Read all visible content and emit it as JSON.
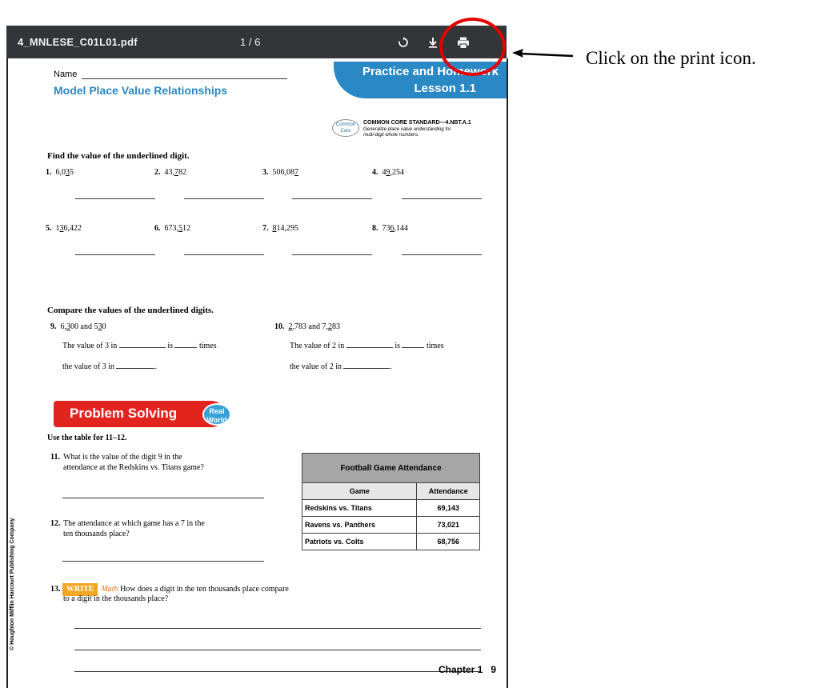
{
  "viewer": {
    "filename": "4_MNLESE_C01L01.pdf",
    "page_indicator": "1 / 6",
    "icons": [
      "rotate-icon",
      "download-icon",
      "print-icon"
    ]
  },
  "worksheet": {
    "name_label": "Name",
    "title": "Model Place Value Relationships",
    "banner_line1": "Practice and Homework",
    "banner_line2": "Lesson 1.1",
    "common_core_badge": "Common Core",
    "standard_heading": "COMMON CORE STANDARD—4.NBT.A.1",
    "standard_text": "Generalize place value understanding for multi-digit whole numbers.",
    "section1_heading": "Find the value of the underlined digit.",
    "problems1": [
      {
        "num": "1.",
        "pre": "6,0",
        "u": "3",
        "post": "5"
      },
      {
        "num": "2.",
        "pre": "43,",
        "u": "7",
        "post": "82"
      },
      {
        "num": "3.",
        "pre": "506,08",
        "u": "7",
        "post": ""
      },
      {
        "num": "4.",
        "pre": "4",
        "u": "9",
        "post": ",254"
      },
      {
        "num": "5.",
        "pre": "1",
        "u": "3",
        "post": "6,422"
      },
      {
        "num": "6.",
        "pre": "673,",
        "u": "5",
        "post": "12"
      },
      {
        "num": "7.",
        "pre": "",
        "u": "8",
        "post": "14,295"
      },
      {
        "num": "8.",
        "pre": "73",
        "u": "6",
        "post": ",144"
      }
    ],
    "section2_heading": "Compare the values of the underlined digits.",
    "p9": {
      "num": "9.",
      "a_pre": "6,",
      "a_u": "3",
      "a_post": "00",
      "and": "and",
      "b_pre": "5",
      "b_u": "3",
      "b_post": "0"
    },
    "p10": {
      "num": "10.",
      "a_pre": "",
      "a_u": "2",
      "a_post": ",783",
      "and": "and",
      "b_pre": "7,",
      "b_u": "2",
      "b_post": "83"
    },
    "p9_line1": {
      "a": "The value of 3 in",
      "b": "is",
      "c": "times"
    },
    "p9_line2": "the value of 3 in",
    "p10_line1": {
      "a": "The value of 2 in",
      "b": "is",
      "c": "times"
    },
    "p10_line2": "the value of 2 in",
    "problem_solving": "Problem Solving",
    "real_world": "Real World",
    "table_instruction": "Use the table for 11–12.",
    "q11_num": "11.",
    "q11": [
      "What is the value of the digit 9 in the",
      "attendance at the Redskins vs. Titans game?"
    ],
    "q12_num": "12.",
    "q12": [
      "The attendance at which game has a 7 in the",
      "ten thousands place?"
    ],
    "table": {
      "caption": "Football Game Attendance",
      "headers": [
        "Game",
        "Attendance"
      ],
      "rows": [
        [
          "Redskins vs. Titans",
          "69,143"
        ],
        [
          "Ravens vs. Panthers",
          "73,021"
        ],
        [
          "Patriots vs. Colts",
          "68,756"
        ]
      ]
    },
    "q13_num": "13.",
    "write_label": "WRITE",
    "math_label": "Math",
    "q13": [
      "How does a digit in the ten thousands place compare",
      "to a digit in the thousands place?"
    ],
    "copyright": "© Houghton Mifflin Harcourt Publishing Company",
    "footer": "Chapter 1   9"
  },
  "annotation": {
    "text": "Click on the print icon.",
    "highlight_color": "#e50000"
  }
}
